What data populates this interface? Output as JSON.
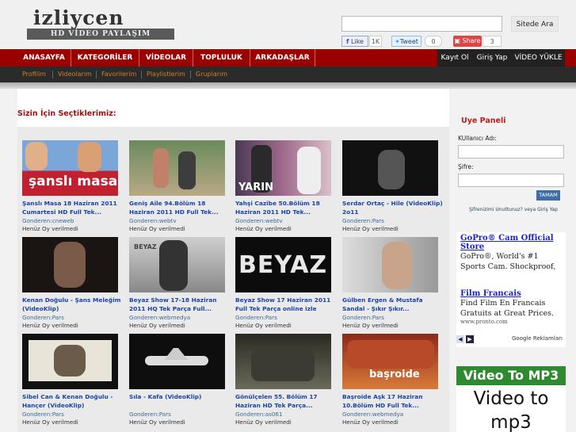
{
  "logo": {
    "main": "izliycen",
    "sub": "HD VİDEO PAYLAŞIM"
  },
  "search": {
    "placeholder": "",
    "button": "Sitede Ara"
  },
  "social": {
    "like": "Like",
    "like_count": "1K",
    "tweet": "Tweet",
    "tweet_count": "0",
    "share": "Share",
    "share_count": "3"
  },
  "nav": {
    "items": [
      "ANASAYFA",
      "KATEGORİLER",
      "VİDEOLAR",
      "TOPLULUK",
      "ARKADAŞLAR"
    ],
    "right": [
      "Kayıt Ol",
      "Giriş Yap",
      "VİDEO YÜKLE"
    ]
  },
  "subnav": [
    "Profilim",
    "Videolarım",
    "Favorilerim",
    "Playlistlerim",
    "Gruplarım"
  ],
  "section_title": "Sizin İçin Seçtiklerimiz:",
  "videos": [
    {
      "title": "Şanslı Masa 18 Haziran 2011 Cumartesi HD Full Tek...",
      "sender": "Gonderen:cneweb",
      "vote": "Henüz Oy verilmedi",
      "thumb_text": "şanslı masa"
    },
    {
      "title": "Geniş Aile 94.Bölüm 18 Haziran 2011 HD Full Tek...",
      "sender": "Gonderen:webtv",
      "vote": "Henüz Oy verilmedi",
      "thumb_text": ""
    },
    {
      "title": "Yahşi Cazibe 50.Bölüm 18 Haziran 2011 HD Tek...",
      "sender": "Gonderen:webtv",
      "vote": "Henüz Oy verilmedi",
      "thumb_text": "YARIN"
    },
    {
      "title": "Serdar Ortaç - Hile (VideoKlip) 2o11",
      "sender": "Gonderen:Pars",
      "vote": "Henüz Oy verilmedi",
      "thumb_text": ""
    },
    {
      "title": "Kenan Doğulu - Şans Meleğim (VideoKlip)",
      "sender": "Gonderen:Pars",
      "vote": "Henüz Oy verilmedi",
      "thumb_text": ""
    },
    {
      "title": "Beyaz Show 17-18 Haziran 2011 HQ Tek Parça Full...",
      "sender": "Gonderen:webmedya",
      "vote": "Henüz Oy verilmedi",
      "thumb_text": "BEYAZ"
    },
    {
      "title": "Beyaz Show 17 Haziran 2011 Full Tek Parça online izle",
      "sender": "Gonderen:Pars",
      "vote": "Henüz Oy verilmedi",
      "thumb_text": "BEYAZ"
    },
    {
      "title": "Gülben Ergen & Mustafa Sandal - Şıkır Şıkır...",
      "sender": "Gonderen:Pars",
      "vote": "Henüz Oy verilmedi",
      "thumb_text": ""
    },
    {
      "title": "Sibel Can & Kenan Doğulu - Hançer (VideoKlip)",
      "sender": "Gonderen:Pars",
      "vote": "Henüz Oy verilmedi",
      "thumb_text": ""
    },
    {
      "title": "Sıla - Kafa (VideoKlip)",
      "sender": "Gonderen:Pars",
      "vote": "Henüz Oy verilmedi",
      "thumb_text": ""
    },
    {
      "title": "Gönülçelen 55. Bölüm 17 Haziran HD Tek Parça...",
      "sender": "Gonderen:as061",
      "vote": "Henüz Oy verilmedi",
      "thumb_text": ""
    },
    {
      "title": "Başroide Aşk 17 Haziran 10.Bölüm HD Full Tek...",
      "sender": "Gonderen:webmedya",
      "vote": "Henüz Oy verilmedi",
      "thumb_text": "başroide"
    }
  ],
  "panel": {
    "title": "Uye Paneli",
    "user_label": "KUllanıcı Adı:",
    "pass_label": "Şifre:",
    "submit": "TAMAM",
    "forgot": "Şifrenizimi Unuttunuz?",
    "forgot_or": "veya",
    "forgot_login": "Giriş Yap"
  },
  "ads": {
    "ad1_title": "GoPro® Cam Official Store",
    "ad1_text": "GoPro®, World's #1 Sports Cam. Shockproof, Waterproof 1080p HD!",
    "ad2_title": "Film Francais",
    "ad2_text": "Find Film En Francais Gratuits at Great Prices.",
    "ad2_url": "www.pronto.com",
    "google": "Google Reklamları"
  },
  "mp3_ad": {
    "title": "Video To MP3",
    "line1": "Video to",
    "line2": "mp3"
  }
}
